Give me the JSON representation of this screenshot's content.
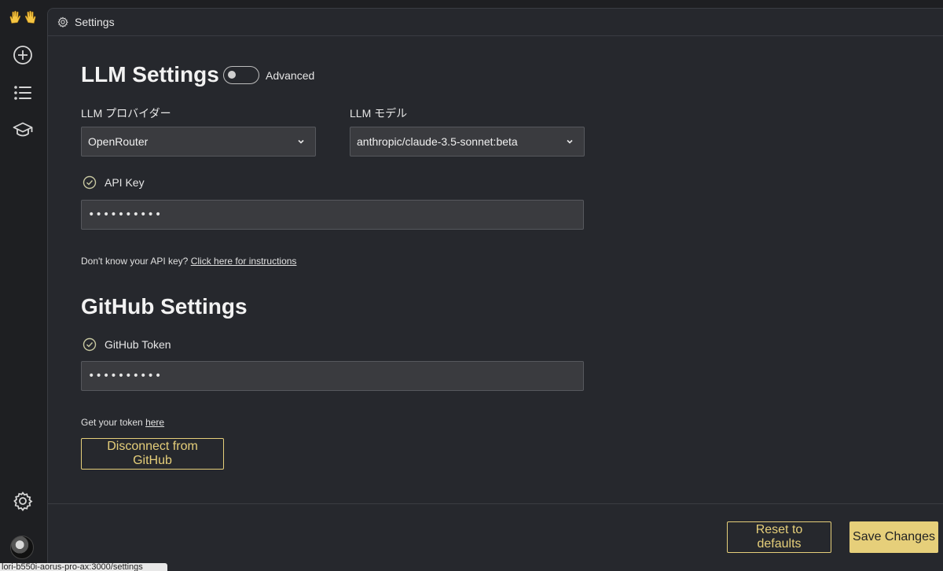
{
  "topbar": {
    "title": "Settings"
  },
  "llm": {
    "title": "LLM Settings",
    "advanced_label": "Advanced",
    "advanced_enabled": false,
    "provider_label": "LLM プロバイダー",
    "provider_value": "OpenRouter",
    "model_label": "LLM モデル",
    "model_value": "anthropic/claude-3.5-sonnet:beta",
    "api_key_label": "API Key",
    "api_key_value": "**********",
    "api_hint": "Don't know your API key?",
    "api_hint_link": "Click here for instructions"
  },
  "github": {
    "title": "GitHub Settings",
    "token_label": "GitHub Token",
    "token_value": "**********",
    "hint": "Get your token",
    "hint_link": "here",
    "disconnect_label": "Disconnect from GitHub"
  },
  "footer": {
    "reset_label": "Reset to defaults",
    "save_label": "Save Changes"
  },
  "statusbar": {
    "url": "lori-b550i-aorus-pro-ax:3000/settings"
  },
  "icons": {
    "logo": "raised-hands-icon",
    "new": "plus-circle-icon",
    "list": "list-icon",
    "learn": "graduation-cap-icon",
    "settings": "gear-icon",
    "check": "check-circle-icon",
    "chevron": "chevron-down-icon"
  },
  "colors": {
    "accent": "#e6cf7a",
    "panel": "#26282d",
    "sidebar": "#1e1f22",
    "input": "#3a3b3f"
  }
}
